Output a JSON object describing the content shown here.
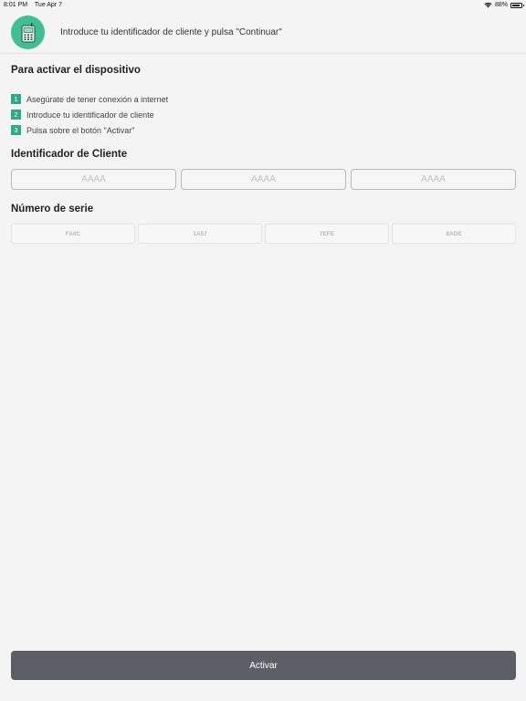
{
  "status_bar": {
    "time": "8:01 PM",
    "date": "Tue Apr 7",
    "battery": "88%",
    "battery_level": 0.88
  },
  "header": {
    "text": "Introduce tu identificador de cliente y pulsa \"Continuar\"",
    "icon": "phone-icon"
  },
  "activation": {
    "title": "Para activar el dispositivo",
    "steps": [
      {
        "num": "1",
        "text": "Asegúrate de tener conexión a internet"
      },
      {
        "num": "2",
        "text": "Introduce tu identificador de cliente"
      },
      {
        "num": "3",
        "text": "Pulsa sobre el botón \"Activar\""
      }
    ]
  },
  "client_id": {
    "title": "Identificador de Cliente",
    "fields": [
      {
        "placeholder": "AAAA",
        "value": ""
      },
      {
        "placeholder": "AAAA",
        "value": ""
      },
      {
        "placeholder": "AAAA",
        "value": ""
      }
    ]
  },
  "serial": {
    "title": "Número de serie",
    "parts": [
      "FA0C",
      "1A57",
      "7EFE",
      "8ADE"
    ]
  },
  "activate_button": {
    "label": "Activar"
  },
  "colors": {
    "accent": "#2eaa87",
    "avatar": "#3fbf94",
    "button": "#5d5f66",
    "background": "#f4f4f4"
  }
}
